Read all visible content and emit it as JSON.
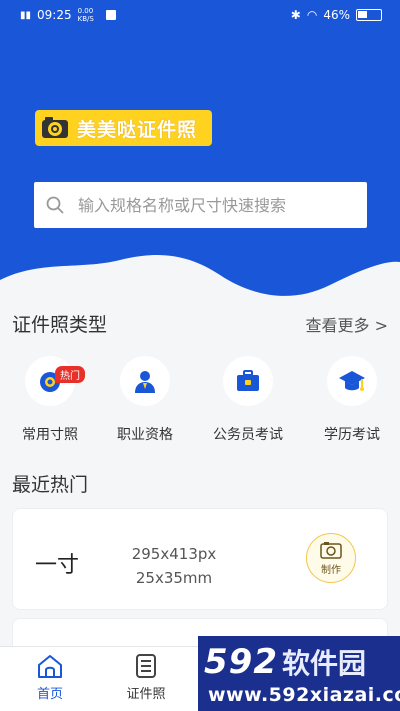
{
  "status_bar": {
    "time": "09:25",
    "left_extra": "0.00 KB/S",
    "battery": "46%"
  },
  "header": {
    "logo_text": "美美哒证件照"
  },
  "search": {
    "placeholder": "输入规格名称或尺寸快速搜索"
  },
  "types_section": {
    "title": "证件照类型",
    "more": "查看更多 >"
  },
  "categories": [
    {
      "label": "常用寸照",
      "icon": "camera-icon",
      "badge": "热门"
    },
    {
      "label": "职业资格",
      "icon": "person-icon"
    },
    {
      "label": "公务员考试",
      "icon": "briefcase-icon"
    },
    {
      "label": "学历考试",
      "icon": "graduation-cap-icon"
    }
  ],
  "recent_section": {
    "title": "最近热门"
  },
  "recent_items": [
    {
      "name": "一寸",
      "pixels": "295x413px",
      "mm": "25x35mm",
      "action": "制作"
    }
  ],
  "tabbar": {
    "items": [
      {
        "label": "首页",
        "icon": "home-icon",
        "active": true
      },
      {
        "label": "证件照",
        "icon": "document-icon",
        "active": false
      }
    ]
  },
  "watermark": {
    "number": "592",
    "name": "软件园",
    "url": "www.592xiazai.com"
  },
  "colors": {
    "brand_blue": "#1a56d8",
    "accent_yellow": "#ffd21f",
    "hot_red": "#e8302a",
    "tab_active": "#1a56d8"
  }
}
